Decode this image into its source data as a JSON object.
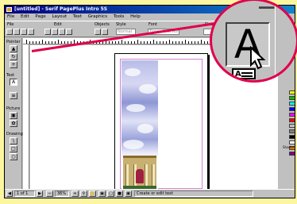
{
  "window": {
    "title": "[untitled] - Serif PagePlus Intro 5S",
    "menu": [
      "File",
      "Edit",
      "Page",
      "Layout",
      "Text",
      "Graphics",
      "Tools",
      "Help"
    ]
  },
  "toolbar": {
    "file_label": "File",
    "edit_label": "Edit",
    "objects_label": "Objects",
    "style_label": "Style",
    "font_label": "Font",
    "size_label": "Size",
    "style_value": "Normal",
    "font_value": "Times New Roman"
  },
  "palette": {
    "pointer_label": "Pointer",
    "text_label": "Text",
    "picture_label": "Picture",
    "drawing_label": "Drawing"
  },
  "status": {
    "page_indicator": "1 of 1",
    "zoom": "36%",
    "message": "Create or edit text"
  },
  "swatches": [
    "#ffff00",
    "#00c000",
    "#00ffff",
    "#0000ff",
    "#ff00ff",
    "#ff0000",
    "#c0c0c0",
    "#808080",
    "#000000",
    "#ffffff",
    "#ff8000",
    "#800080"
  ],
  "shades_label": "Shades",
  "callout": {
    "tool_letter": "A",
    "frame_letter": "A"
  },
  "colors": {
    "titlebar": "#000080",
    "callout_ring": "#e0004a",
    "background": "#fdf6a0"
  }
}
